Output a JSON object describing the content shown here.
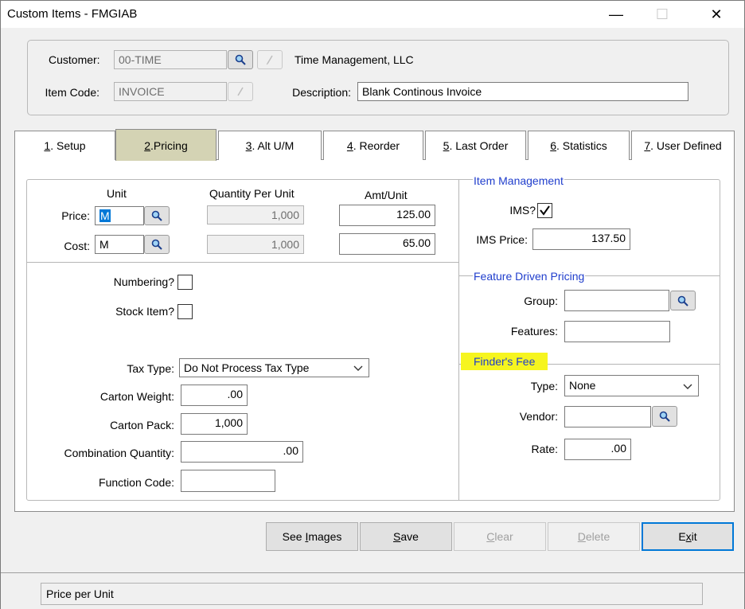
{
  "window": {
    "title": "Custom Items - FMGIAB",
    "minimize": "—",
    "maximize": "☐",
    "close": "✕"
  },
  "header": {
    "customer_label": "Customer:",
    "customer_code": "00-TIME",
    "customer_name": "Time Management, LLC",
    "item_code_label": "Item Code:",
    "item_code": "INVOICE",
    "description_label": "Description:",
    "description": "Blank Continous Invoice"
  },
  "tabs": [
    {
      "num": "1",
      "label": ". Setup",
      "active": false
    },
    {
      "num": "2",
      "label": ".Pricing",
      "active": true
    },
    {
      "num": "3",
      "label": ". Alt U/M",
      "active": false
    },
    {
      "num": "4",
      "label": ". Reorder",
      "active": false
    },
    {
      "num": "5",
      "label": ". Last Order",
      "active": false
    },
    {
      "num": "6",
      "label": ". Statistics",
      "active": false
    },
    {
      "num": "7",
      "label": ". User Defined",
      "active": false
    }
  ],
  "pricing": {
    "unit_header": "Unit",
    "qty_header": "Quantity Per Unit",
    "amt_header": "Amt/Unit",
    "price_label": "Price:",
    "price_unit": "M",
    "price_qty": "1,000",
    "price_amt": "125.00",
    "cost_label": "Cost:",
    "cost_unit": "M",
    "cost_qty": "1,000",
    "cost_amt": "65.00"
  },
  "options": {
    "numbering_label": "Numbering?",
    "numbering_checked": false,
    "stock_label": "Stock Item?",
    "stock_checked": false,
    "tax_type_label": "Tax Type:",
    "tax_type_value": "Do Not Process Tax Type",
    "carton_weight_label": "Carton Weight:",
    "carton_weight": ".00",
    "carton_pack_label": "Carton Pack:",
    "carton_pack": "1,000",
    "combo_qty_label": "Combination Quantity:",
    "combo_qty": ".00",
    "function_code_label": "Function Code:",
    "function_code": ""
  },
  "item_management": {
    "title": "Item Management",
    "ims_label": "IMS?",
    "ims_checked": true,
    "ims_price_label": "IMS Price:",
    "ims_price": "137.50"
  },
  "feature_pricing": {
    "title": "Feature Driven Pricing",
    "group_label": "Group:",
    "group": "",
    "features_label": "Features:",
    "features": ""
  },
  "finders_fee": {
    "title": "Finder's Fee",
    "type_label": "Type:",
    "type_value": "None",
    "vendor_label": "Vendor:",
    "vendor": "",
    "rate_label": "Rate:",
    "rate": ".00"
  },
  "buttons": {
    "see_images_pre": "See ",
    "see_images_u": "I",
    "see_images_post": "mages",
    "save_u": "S",
    "save_post": "ave",
    "clear_u": "C",
    "clear_post": "lear",
    "delete_u": "D",
    "delete_post": "elete",
    "exit_pre": "E",
    "exit_u": "x",
    "exit_post": "it"
  },
  "status": {
    "text": "Price per Unit"
  },
  "colors": {
    "active_tab": "#d4d3b4",
    "section_title": "#1f3dcc",
    "highlight": "#f6f51f",
    "default_button_border": "#0078d7"
  }
}
